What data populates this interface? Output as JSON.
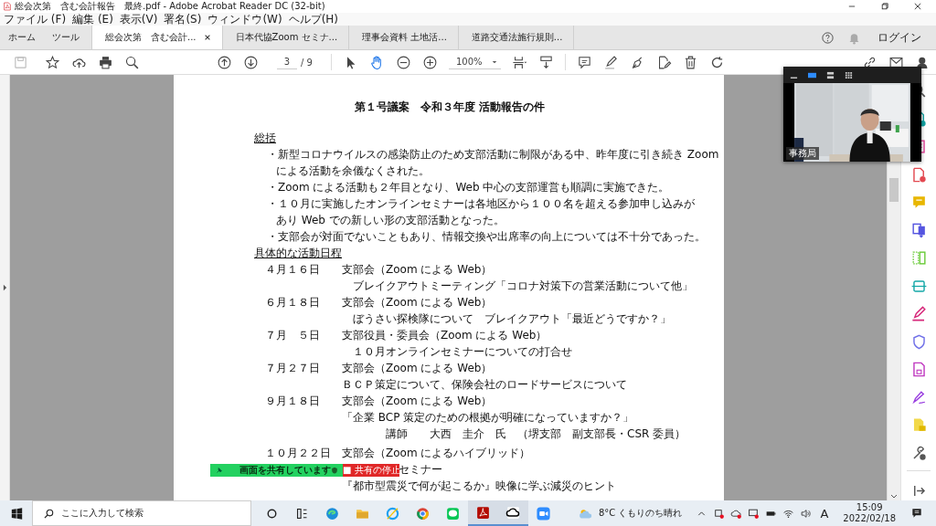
{
  "window": {
    "title": "総会次第　含む会計報告　最終.pdf - Adobe Acrobat Reader DC (32-bit)"
  },
  "menu": [
    "ファイル (F)",
    "編集 (E)",
    "表示(V)",
    "署名(S)",
    "ウィンドウ(W)",
    "ヘルプ(H)"
  ],
  "tabs": [
    {
      "label": "ホーム",
      "kind": "nav",
      "selected": false
    },
    {
      "label": "ツール",
      "kind": "nav",
      "selected": false
    },
    {
      "label": "総会次第　含む会計...",
      "kind": "doc",
      "selected": true
    },
    {
      "label": "日本代協Zoom セミナ...",
      "kind": "doc",
      "selected": false
    },
    {
      "label": "理事会資料 土地活...",
      "kind": "doc",
      "selected": false
    },
    {
      "label": "道路交通法施行規則...",
      "kind": "doc",
      "selected": false
    }
  ],
  "login": "ログイン",
  "toolbar": {
    "page": "3",
    "page_total": "/ 9",
    "zoom": "100%"
  },
  "document": {
    "title": "第１号議案　令和３年度 活動報告の件",
    "summary_heading": "総括",
    "bullets": [
      {
        "lines": [
          "・新型コロナウイルスの感染防止のため支部活動に制限がある中、昨年度に引き続き Zoom",
          "による活動を余儀なくされた。"
        ]
      },
      {
        "lines": [
          "・Zoom による活動も２年目となり、Web 中心の支部運営も順調に実施できた。"
        ]
      },
      {
        "lines": [
          "・１０月に実施したオンラインセミナーは各地区から１００名を超える参加申し込みが",
          "あり Web での新しい形の支部活動となった。"
        ]
      },
      {
        "lines": [
          "・支部会が対面でないこともあり、情報交換や出席率の向上については不十分であった。"
        ]
      }
    ],
    "schedule_heading": "具体的な活動日程",
    "schedule": [
      {
        "date": "４月１６日",
        "event": "支部会（Zoom による Web）",
        "details": [
          "　ブレイクアウトミーティング「コロナ対策下の営業活動について他」"
        ]
      },
      {
        "date": "６月１８日",
        "event": "支部会（Zoom による Web）",
        "details": [
          "　ぼうさい探検隊について　ブレイクアウト「最近どうですか？」"
        ]
      },
      {
        "date": "７月　５日",
        "event": "支部役員・委員会（Zoom による Web）",
        "details": [
          "　１０月オンラインセミナーについての打合せ"
        ]
      },
      {
        "date": "７月２７日",
        "event": "支部会（Zoom による Web）",
        "details": [
          "ＢＣＰ策定について、保険会社のロードサービスについて"
        ]
      },
      {
        "date": "９月１８日",
        "event": "支部会（Zoom による Web）",
        "details": [
          "「企業 BCP 策定のための根拠が明確になっていますか？」",
          "　　　　講師　　大西　圭介　氏　（堺支部　副支部長・CSR 委員）"
        ]
      },
      {
        "date": "１０月２２日",
        "event": "支部会（Zoom によるハイブリッド）",
        "covered_line": "セミナー",
        "details": [
          "『都市型震災で何が起こるか』映像に学ぶ減災のヒント"
        ]
      }
    ]
  },
  "video": {
    "label": "事務局"
  },
  "share_bar": {
    "status": "画面を共有しています",
    "stop": "■ 共有の停止"
  },
  "taskbar": {
    "search": "ここに入力して検索",
    "weather": "8°C くもりのち晴れ",
    "ime": "A",
    "time": "15:09",
    "date": "2022/02/18"
  }
}
